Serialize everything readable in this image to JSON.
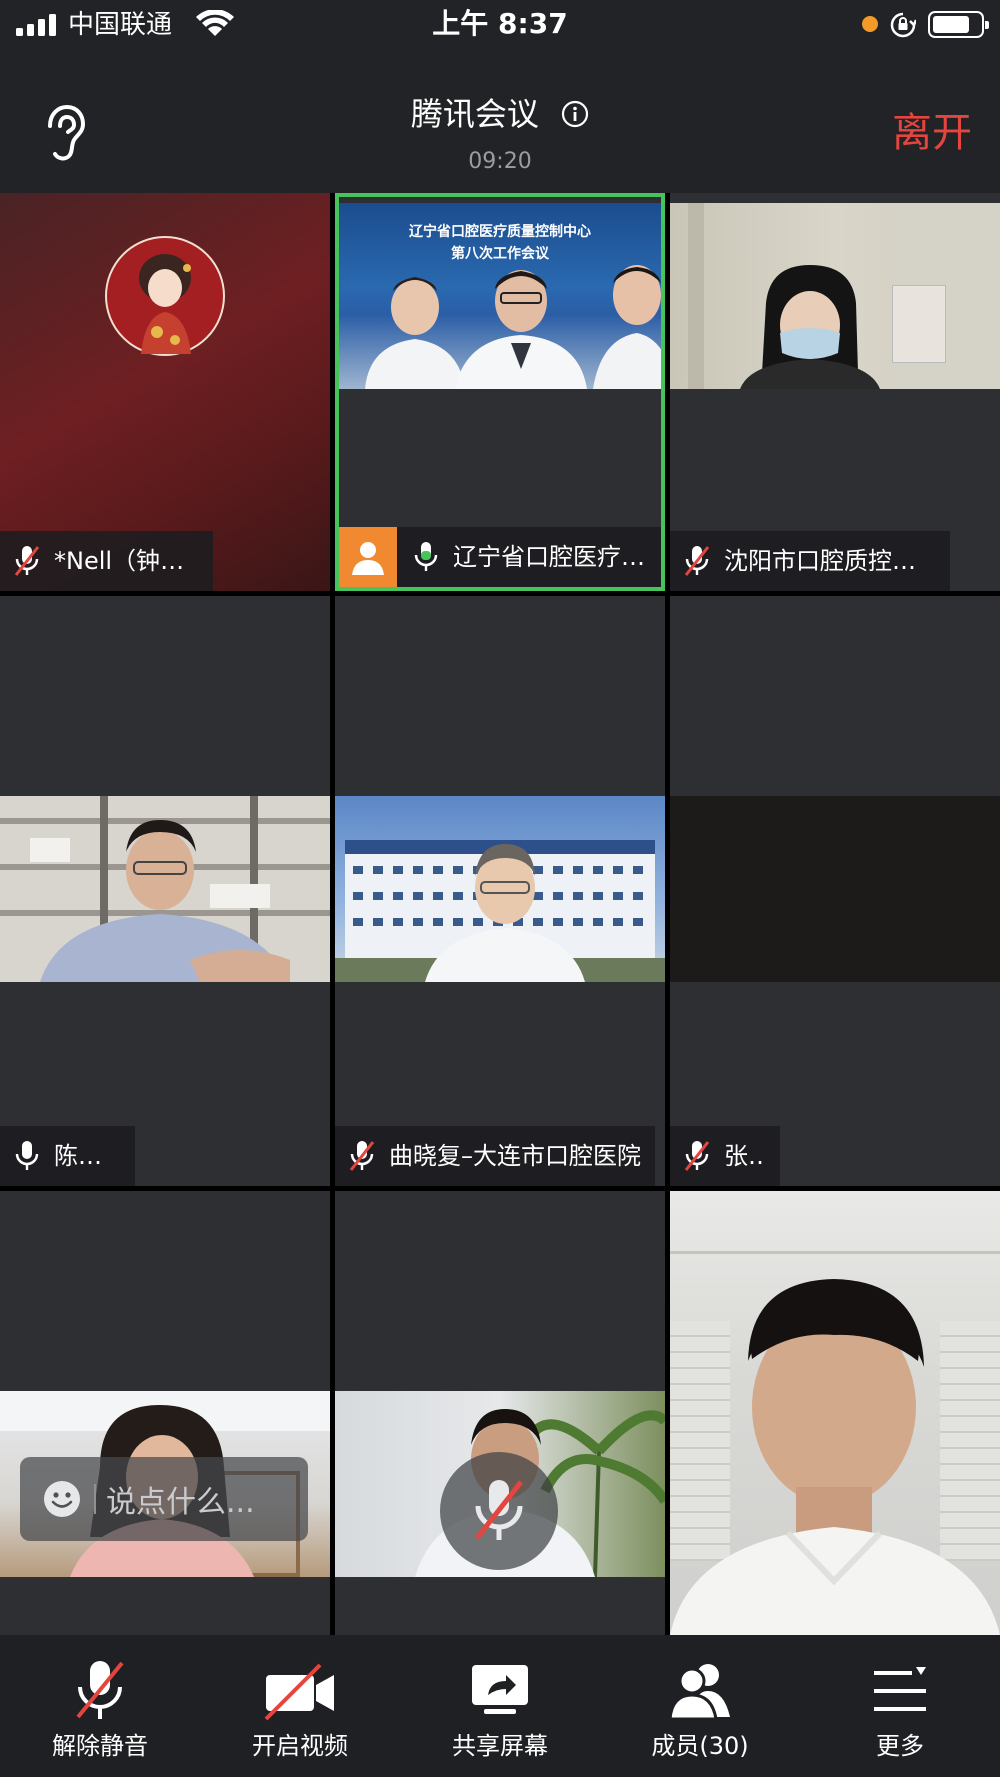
{
  "status_bar": {
    "carrier": "中国联通",
    "time": "上午 8:37"
  },
  "header": {
    "title": "腾讯会议",
    "clock": "09:20",
    "leave_label": "离开"
  },
  "participants": [
    {
      "name": "*Nell（钟情）",
      "mic": "muted"
    },
    {
      "name": "辽宁省口腔医疗…",
      "mic": "active"
    },
    {
      "name": "沈阳市口腔质控中心",
      "mic": "muted"
    },
    {
      "name": "陈小冬",
      "mic": "on"
    },
    {
      "name": "曲晓复–大连市口腔医院",
      "mic": "muted"
    },
    {
      "name": "张蕾",
      "mic": "muted"
    }
  ],
  "slide": {
    "line1": "辽宁省口腔医疗质量控制中心",
    "line2": "第八次工作会议"
  },
  "chat": {
    "placeholder": "说点什么..."
  },
  "toolbar": {
    "items": [
      {
        "label": "解除静音",
        "icon": "mic-muted-icon"
      },
      {
        "label": "开启视频",
        "icon": "video-off-icon"
      },
      {
        "label": "共享屏幕",
        "icon": "share-screen-icon"
      },
      {
        "label": "成员(30)",
        "icon": "members-icon"
      },
      {
        "label": "更多",
        "icon": "more-icon"
      }
    ]
  },
  "colors": {
    "accent_green": "#46c35a",
    "leave_red": "#e4453e",
    "avatar_orange": "#f0892f",
    "tile_bg": "#2d2f33"
  }
}
